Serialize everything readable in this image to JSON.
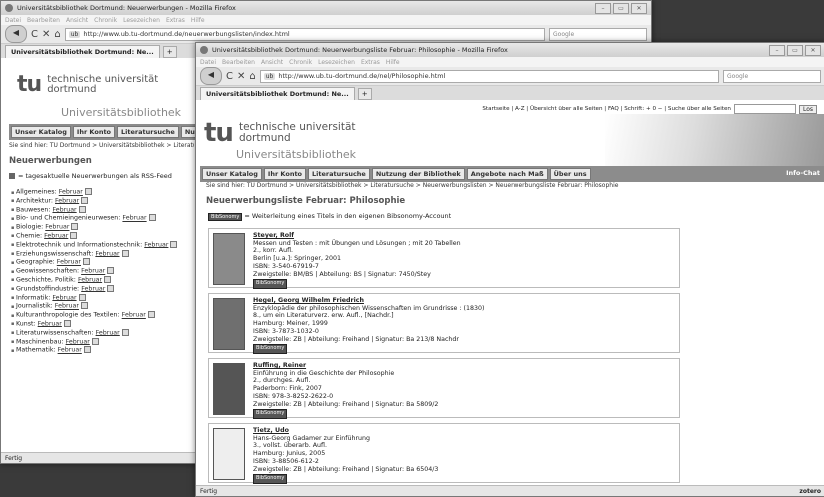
{
  "win1": {
    "title": "Universitätsbibliothek Dortmund: Neuerwerbungen - Mozilla Firefox",
    "menu": [
      "Datei",
      "Bearbeiten",
      "Ansicht",
      "Chronik",
      "Lesezeichen",
      "Extras",
      "Hilfe"
    ],
    "url_badge": "ub",
    "url": "http://www.ub.tu-dortmund.de/neuerwerbungslisten/index.html",
    "search_placeholder": "Google",
    "tab": "Universitätsbibliothek Dortmund: Ne...",
    "tab_plus": "+",
    "logo_mark": "tu",
    "logo_line1": "technische universität",
    "logo_line2": "dortmund",
    "ub_label": "Universitätsbibliothek",
    "nav": [
      "Unser Katalog",
      "Ihr Konto",
      "Literatursuche",
      "Nutzung"
    ],
    "crumb": "Sie sind hier: TU Dortmund > Universitätsbibliothek > Literatu",
    "heading": "Neuerwerbungen",
    "rss_text": "= tagesaktuelle Neuerwerbungen als RSS-Feed",
    "link_text": "Februar",
    "subjects": [
      "Allgemeines:",
      "Architektur:",
      "Bauwesen:",
      "Bio- und Chemieingenieurwesen:",
      "Biologie:",
      "Chemie:",
      "Elektrotechnik und Informationstechnik:",
      "Erziehungswissenschaft:",
      "Geographie:",
      "Geowissenschaften:",
      "Geschichte, Politik:",
      "Grundstoffindustrie:",
      "Informatik:",
      "Journalistik:",
      "Kulturanthropologie des Textilen:",
      "Kunst:",
      "Literaturwissenschaften:",
      "Maschinenbau:",
      "Mathematik:"
    ],
    "status": "Fertig"
  },
  "win2": {
    "title": "Universitätsbibliothek Dortmund: Neuerwerbungsliste Februar: Philosophie - Mozilla Firefox",
    "menu": [
      "Datei",
      "Bearbeiten",
      "Ansicht",
      "Chronik",
      "Lesezeichen",
      "Extras",
      "Hilfe"
    ],
    "url_badge": "ub",
    "url": "http://www.ub.tu-dortmund.de/nel/Philosophie.html",
    "search_placeholder": "Google",
    "tab": "Universitätsbibliothek Dortmund: Ne...",
    "tab_plus": "+",
    "toplinks": "Startseite | A-Z | Übersicht über alle Seiten | FAQ | Schrift: + 0 − | Suche über alle Seiten",
    "search_button": "Los",
    "logo_mark": "tu",
    "logo_line1": "technische universität",
    "logo_line2": "dortmund",
    "ub_label": "Universitätsbibliothek",
    "nav": [
      "Unser Katalog",
      "Ihr Konto",
      "Literatursuche",
      "Nutzung der Bibliothek",
      "Angebote nach Maß",
      "Über uns"
    ],
    "info_chat": "Info-Chat",
    "crumb": "Sie sind hier: TU Dortmund > Universitätsbibliothek > Literatursuche > Neuerwerbungslisten > Neuerwerbungsliste Februar: Philosophie",
    "heading": "Neuerwerbungsliste Februar: Philosophie",
    "bibsonomy_tag": "BibSonomy",
    "bibsonomy_text": "= Weiterleitung eines Titels in den eigenen Bibsonomy-Account",
    "books": [
      {
        "author": "Steyer, Rolf",
        "lines": [
          "Messen und Testen : mit Übungen und Lösungen ; mit 20 Tabellen",
          "2., korr. Aufl.",
          "Berlin [u.a.]: Springer, 2001",
          "ISBN: 3-540-67919-7",
          "Zweigstelle: BM/BS | Abteilung: BS | Signatur: 7450/Stey"
        ]
      },
      {
        "author": "Hegel, Georg Wilhelm Friedrich",
        "lines": [
          "Enzyklopädie der philosophischen Wissenschaften im Grundrisse : (1830)",
          "8., um ein Literaturverz. erw. Aufl., [Nachdr.]",
          "Hamburg: Meiner, 1999",
          "ISBN: 3-7873-1032-0",
          "Zweigstelle: ZB | Abteilung: Freihand | Signatur: Ba 213/8 Nachdr"
        ]
      },
      {
        "author": "Ruffing, Reiner",
        "lines": [
          "Einführung in die Geschichte der Philosophie",
          "2., durchges. Aufl.",
          "Paderborn: Fink, 2007",
          "ISBN: 978-3-8252-2622-0",
          "Zweigstelle: ZB | Abteilung: Freihand | Signatur: Ba 5809/2"
        ]
      },
      {
        "author": "Tietz, Udo",
        "lines": [
          "Hans-Georg Gadamer zur Einführung",
          "3., vollst. überarb. Aufl.",
          "Hamburg: Junius, 2005",
          "ISBN: 3-88506-612-2",
          "Zweigstelle: ZB | Abteilung: Freihand | Signatur: Ba 6504/3"
        ]
      }
    ],
    "status": "Fertig",
    "status_right": "zotero"
  }
}
